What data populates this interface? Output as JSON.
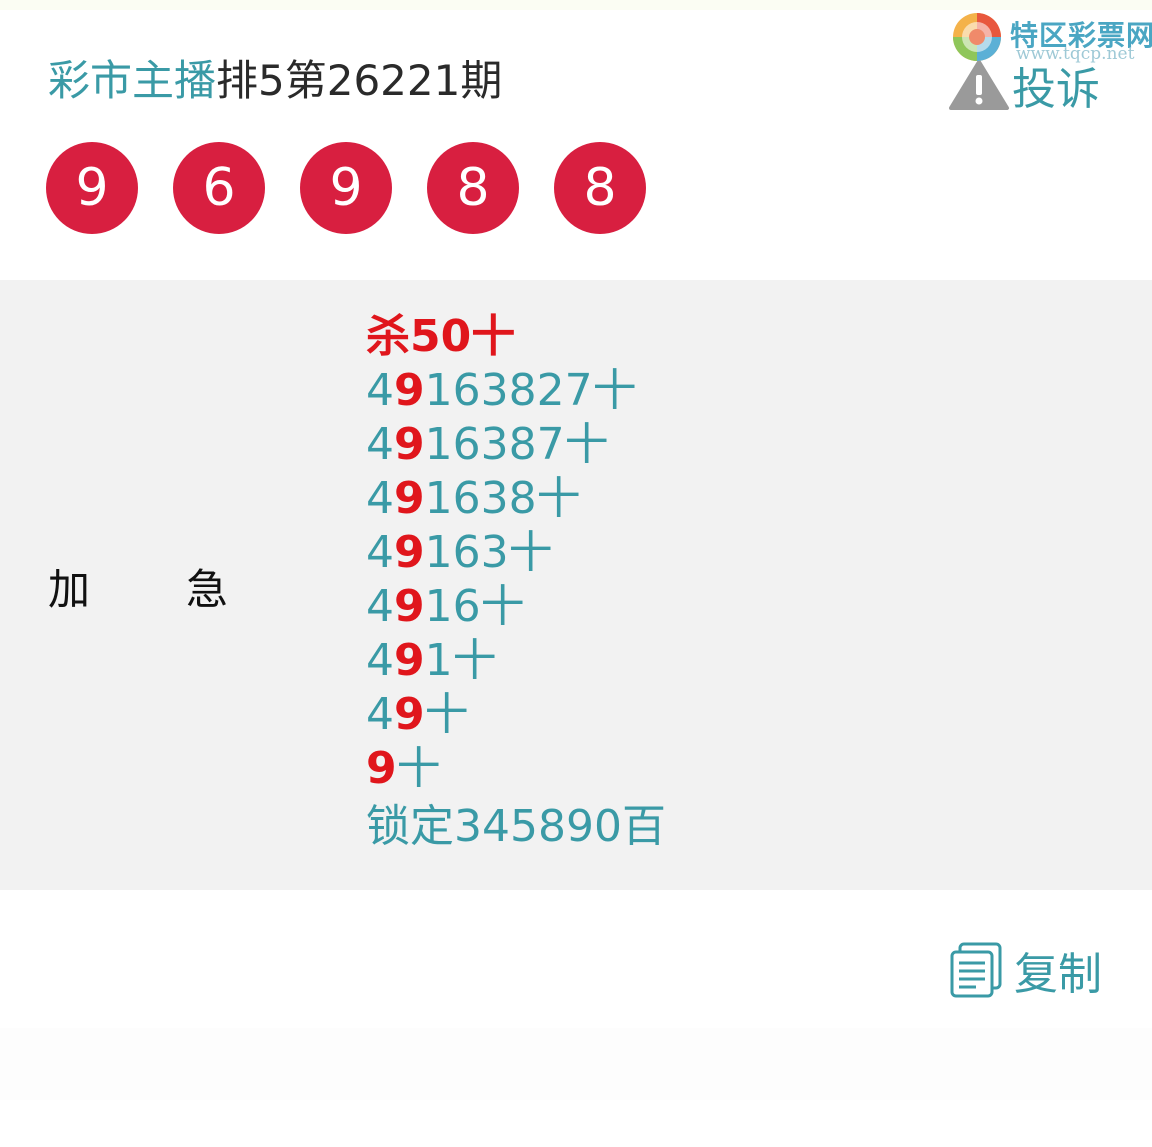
{
  "header": {
    "source_label": "彩市主播",
    "issue_title": "排5第26221期",
    "complain_label": "投诉",
    "complain_icon": "warning-triangle-icon"
  },
  "watermark": {
    "name": "特区彩票网",
    "url": "www.tqcp.net"
  },
  "draw_numbers": [
    "9",
    "6",
    "9",
    "8",
    "8"
  ],
  "colors": {
    "ball": "#d81f40",
    "accent_teal": "#3a9aa6",
    "highlight_red": "#e0161c",
    "content_bg": "#f2f2f2"
  },
  "content": {
    "tag_chars": [
      "加",
      "急"
    ],
    "kill_line": "杀50十",
    "lines": [
      {
        "pre": "4",
        "hl": "9",
        "post": "163827十"
      },
      {
        "pre": "4",
        "hl": "9",
        "post": "16387十"
      },
      {
        "pre": "4",
        "hl": "9",
        "post": "1638十"
      },
      {
        "pre": "4",
        "hl": "9",
        "post": "163十"
      },
      {
        "pre": "4",
        "hl": "9",
        "post": "16十"
      },
      {
        "pre": "4",
        "hl": "9",
        "post": "1十"
      },
      {
        "pre": "4",
        "hl": "9",
        "post": "十"
      },
      {
        "pre": "",
        "hl": "9",
        "post": "十"
      }
    ],
    "lock_line": "锁定345890百"
  },
  "footer": {
    "copy_label": "复制",
    "copy_icon": "copy-document-icon"
  }
}
